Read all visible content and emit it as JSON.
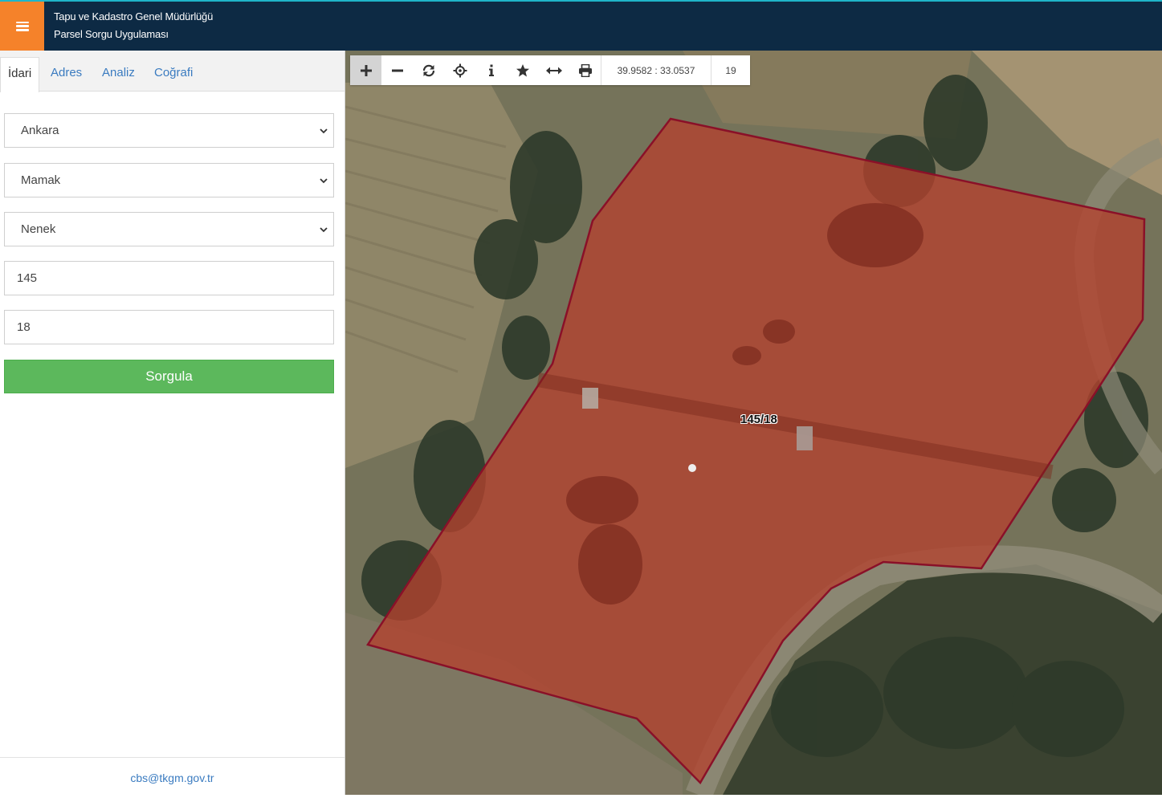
{
  "header": {
    "title_line1": "Tapu ve Kadastro Genel Müdürlüğü",
    "title_line2": "Parsel Sorgu Uygulaması",
    "menu_icon": "hamburger-menu-icon"
  },
  "sidebar": {
    "tabs": [
      {
        "label": "İdari",
        "active": true
      },
      {
        "label": "Adres",
        "active": false
      },
      {
        "label": "Analiz",
        "active": false
      },
      {
        "label": "Coğrafi",
        "active": false
      }
    ],
    "province": "Ankara",
    "district": "Mamak",
    "neighborhood": "Nenek",
    "block_number": "145",
    "parcel_number": "18",
    "query_button": "Sorgula",
    "footer_email": "cbs@tkgm.gov.tr"
  },
  "map": {
    "coordinates": "39.9582 : 33.0537",
    "zoom_level": "19",
    "parcel_label": "145/18",
    "parcel_fill_color": "#b4412e",
    "parcel_border_color": "#8a1028",
    "tools": [
      "zoom-in-icon",
      "zoom-out-icon",
      "refresh-icon",
      "locate-icon",
      "info-icon",
      "favorite-star-icon",
      "measure-distance-icon",
      "print-icon"
    ]
  },
  "colors": {
    "header_bg": "#0d2a44",
    "menu_button": "#f5822a",
    "query_button": "#5cb85c",
    "link": "#3a7bc0"
  }
}
